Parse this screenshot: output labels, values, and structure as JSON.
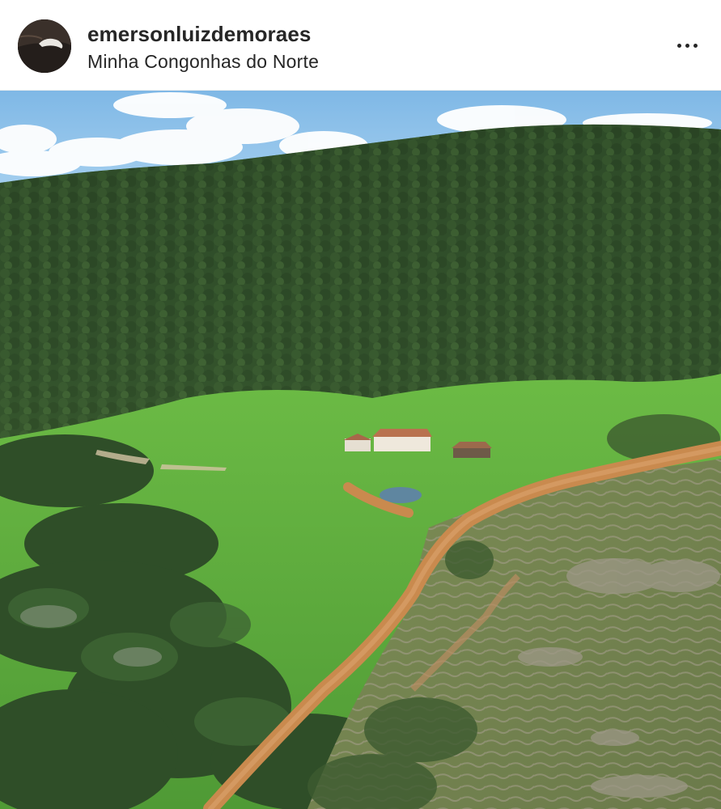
{
  "post": {
    "username": "emersonluizdemoraes",
    "location": "Minha Congonhas do Norte",
    "avatar_icon": "profile-avatar",
    "more_icon": "more-options-icon",
    "photo_subject": "aerial-landscape"
  },
  "colors": {
    "sky": "#8ec4ec",
    "forest": "#2f4b2a",
    "grass": "#5aa83a",
    "road": "#c98a4e",
    "text": "#262626"
  }
}
